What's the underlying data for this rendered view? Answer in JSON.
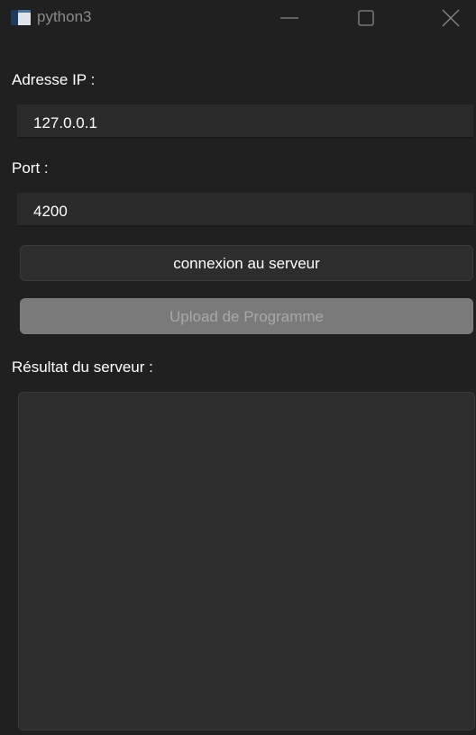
{
  "window": {
    "title": "python3",
    "icons": {
      "app": "python-app-icon",
      "minimize": "minimize-icon",
      "maximize": "maximize-icon",
      "close": "close-icon"
    }
  },
  "form": {
    "ip_label": "Adresse IP :",
    "ip_value": "127.0.0.1",
    "port_label": "Port :",
    "port_value": "4200",
    "connect_button": "connexion au serveur",
    "upload_button": "Upload de Programme",
    "upload_enabled": false,
    "result_label": "Résultat du serveur :",
    "result_text": ""
  },
  "colors": {
    "background": "#202020",
    "field": "#2b2b2b",
    "disabled_button": "#7a7a7a"
  }
}
